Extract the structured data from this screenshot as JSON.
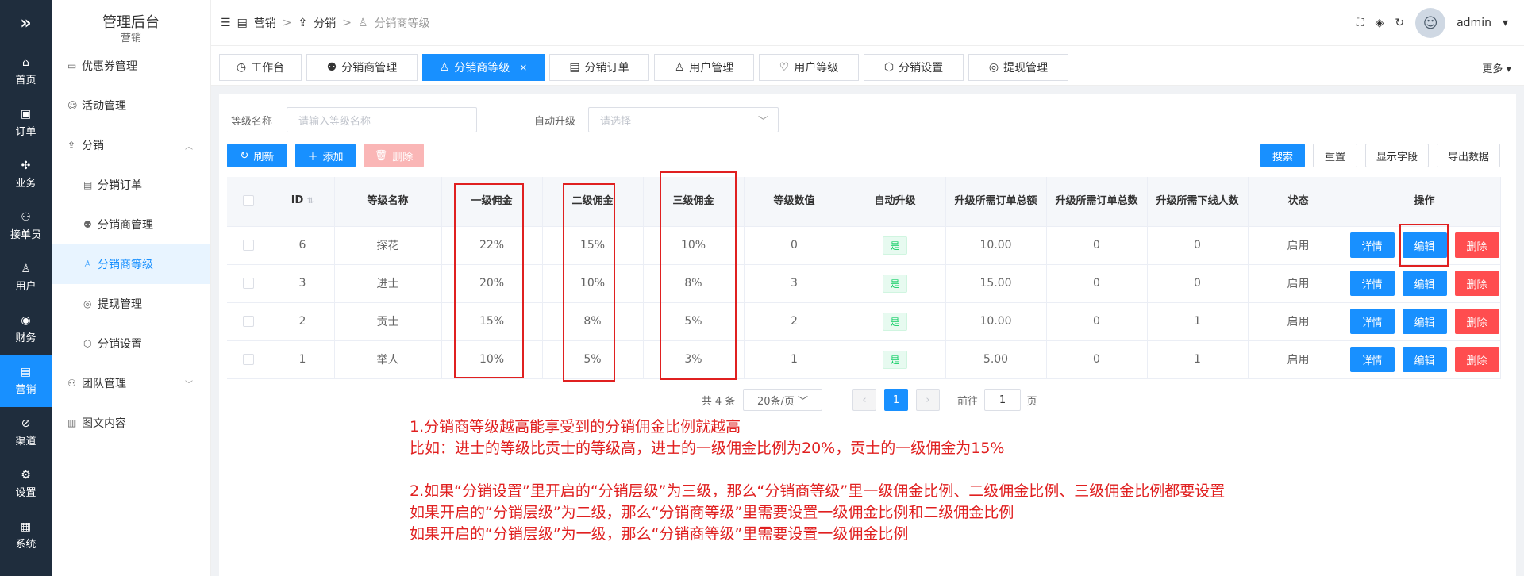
{
  "rail": {
    "logo": "»",
    "items": [
      {
        "label": "首页",
        "icon": "home-icon"
      },
      {
        "label": "订单",
        "icon": "order-icon"
      },
      {
        "label": "业务",
        "icon": "grid-icon"
      },
      {
        "label": "接单员",
        "icon": "bike-icon"
      },
      {
        "label": "用户",
        "icon": "user-icon"
      },
      {
        "label": "财务",
        "icon": "finance-icon"
      },
      {
        "label": "营销",
        "icon": "chart-icon"
      },
      {
        "label": "渠道",
        "icon": "channel-icon"
      },
      {
        "label": "设置",
        "icon": "gear-icon"
      },
      {
        "label": "系统",
        "icon": "system-icon"
      }
    ]
  },
  "sidebar": {
    "title": "管理后台",
    "sub": "营销",
    "items": [
      {
        "label": "优惠券管理"
      },
      {
        "label": "活动管理"
      },
      {
        "label": "分销"
      },
      {
        "label": "分销订单"
      },
      {
        "label": "分销商管理"
      },
      {
        "label": "分销商等级"
      },
      {
        "label": "提现管理"
      },
      {
        "label": "分销设置"
      },
      {
        "label": "团队管理"
      },
      {
        "label": "图文内容"
      }
    ]
  },
  "breadcrumb": {
    "items": [
      "营销",
      "分销",
      "分销商等级"
    ]
  },
  "header": {
    "user": "admin"
  },
  "tabs": {
    "items": [
      {
        "label": "工作台"
      },
      {
        "label": "分销商管理"
      },
      {
        "label": "分销商等级"
      },
      {
        "label": "分销订单"
      },
      {
        "label": "用户管理"
      },
      {
        "label": "用户等级"
      },
      {
        "label": "分销设置"
      },
      {
        "label": "提现管理"
      }
    ],
    "close": "×",
    "more": "更多"
  },
  "filters": {
    "name_label": "等级名称",
    "name_placeholder": "请输入等级名称",
    "auto_label": "自动升级",
    "auto_placeholder": "请选择"
  },
  "toolbar": {
    "refresh": "刷新",
    "add": "添加",
    "delete": "删除",
    "search": "搜索",
    "reset": "重置",
    "show_fields": "显示字段",
    "export": "导出数据"
  },
  "table": {
    "headers": [
      "ID",
      "等级名称",
      "一级佣金",
      "二级佣金",
      "三级佣金",
      "等级数值",
      "自动升级",
      "升级所需订单总额",
      "升级所需订单总数",
      "升级所需下线人数",
      "状态",
      "操作"
    ],
    "rows": [
      {
        "id": "6",
        "name": "探花",
        "c1": "22%",
        "c2": "15%",
        "c3": "10%",
        "level": "0",
        "auto": "是",
        "amount": "10.00",
        "orders": "0",
        "downline": "0",
        "status": "启用"
      },
      {
        "id": "3",
        "name": "进士",
        "c1": "20%",
        "c2": "10%",
        "c3": "8%",
        "level": "3",
        "auto": "是",
        "amount": "15.00",
        "orders": "0",
        "downline": "0",
        "status": "启用"
      },
      {
        "id": "2",
        "name": "贡士",
        "c1": "15%",
        "c2": "8%",
        "c3": "5%",
        "level": "2",
        "auto": "是",
        "amount": "10.00",
        "orders": "0",
        "downline": "1",
        "status": "启用"
      },
      {
        "id": "1",
        "name": "举人",
        "c1": "10%",
        "c2": "5%",
        "c3": "3%",
        "level": "1",
        "auto": "是",
        "amount": "5.00",
        "orders": "0",
        "downline": "1",
        "status": "启用"
      }
    ],
    "ops": {
      "detail": "详情",
      "edit": "编辑",
      "delete": "删除"
    }
  },
  "pager": {
    "total": "共 4 条",
    "size": "20条/页",
    "prev": "‹",
    "page": "1",
    "next": "›",
    "goto": "前往",
    "goto_value": "1",
    "page_unit": "页"
  },
  "notes": [
    "1.分销商等级越高能享受到的分销佣金比例就越高",
    "比如：进士的等级比贡士的等级高，进士的一级佣金比例为20%，贡士的一级佣金为15%",
    "",
    "2.如果“分销设置”里开启的“分销层级”为三级，那么“分销商等级”里一级佣金比例、二级佣金比例、三级佣金比例都要设置",
    "如果开启的“分销层级”为二级，那么“分销商等级”里需要设置一级佣金比例和二级佣金比例",
    "如果开启的“分销层级”为一级，那么“分销商等级”里需要设置一级佣金比例"
  ],
  "colors": {
    "primary": "#1890ff",
    "danger": "#ff4d4f",
    "annotation": "#e02020",
    "rail": "#1f2d3d"
  }
}
